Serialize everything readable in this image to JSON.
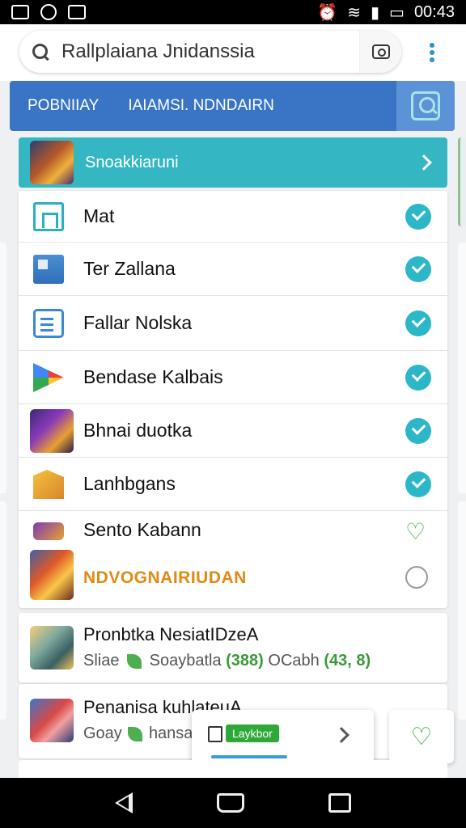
{
  "status_bar": {
    "time": "00:43",
    "left_icons": [
      "image-icon",
      "shield-icon",
      "gallery-icon"
    ],
    "right_icons": [
      "alarm-icon",
      "wifi-icon",
      "signal-icon",
      "battery-icon"
    ]
  },
  "search": {
    "query": "Rallplaiana Jnidanssia",
    "placeholder": ""
  },
  "nav": {
    "tab1": "PОBNIIAY",
    "tab2": "IAIAMSI. NDNDAIRN"
  },
  "featured": {
    "label": "Snoakkiaruni"
  },
  "list_items": [
    {
      "label": "Mat",
      "icon": "house-icon",
      "status": "check"
    },
    {
      "label": "Ter Zallana",
      "icon": "home-icon",
      "status": "check"
    },
    {
      "label": "Fallar Nolska",
      "icon": "edit-icon",
      "status": "check"
    },
    {
      "label": "Bendase Kalbais",
      "icon": "play-icon",
      "status": "check"
    },
    {
      "label": "Bhnai duotka",
      "icon": "game-icon",
      "status": "check"
    },
    {
      "label": "Lanhbgans",
      "icon": "map-icon",
      "status": "check"
    },
    {
      "label": "Sento Kabann",
      "icon": "game-icon",
      "status": "heart"
    }
  ],
  "sub_item": {
    "label": "NDVOGNAIRIUDAN",
    "status": "ring"
  },
  "cards": [
    {
      "title": "Pronbtka NesiatIDzeA",
      "meta_prefix": "Sliae",
      "meta_middle": "Soaybatla",
      "meta_count": "(388)",
      "meta_suffix": "OCabh",
      "meta_rating": "(43, 8)"
    },
    {
      "title": "Penanisa kuhlateuA",
      "meta_prefix": "Goay",
      "meta_middle": "hansaik"
    }
  ],
  "toast": {
    "badge": "Laykbor"
  },
  "colors": {
    "accent": "#34b6c3",
    "nav_blue": "#3a74c4",
    "check": "#2cb7c8",
    "green": "#2fa83a",
    "orange": "#e08a14"
  }
}
